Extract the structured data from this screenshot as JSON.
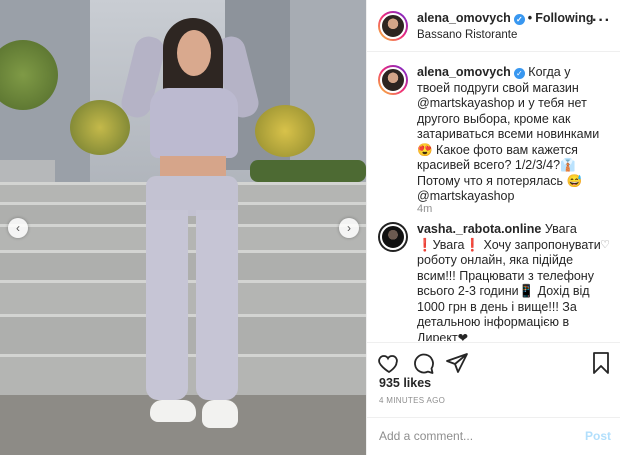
{
  "post": {
    "username": "alena_omovych",
    "follow_label": "Following",
    "location": "Bassano Ristorante",
    "more_label": "···"
  },
  "caption": {
    "username": "alena_omovych",
    "text": "Когда у твоей подруги свой магазин @martskayashop и у тебя нет другого выбора, кроме как затариваться всеми новинками😍 Какое фото вам кажется красивей всего? 1/2/3/4?👔Потому что я потерялась 😅 @martskayashop",
    "time": "4m"
  },
  "comment": {
    "username": "vasha._rabota.online",
    "first_word": "Увага",
    "text": "❗Увага❗ Хочу запропонувати роботу онлайн, яка підійде всим!!! Працювати з телефону всього 2-3 години📱 Дохід від 1000 грн в день і вище!!! За детальною інформацією в Директ❤"
  },
  "stats": {
    "likes": "935 likes",
    "posted": "4 MINUTES AGO"
  },
  "add_comment": {
    "placeholder": "Add a comment...",
    "post_label": "Post"
  },
  "icons": {
    "prev": "chevron-left-icon",
    "next": "chevron-right-icon",
    "like": "heart-icon",
    "comment": "comment-icon",
    "share": "share-icon",
    "save": "bookmark-icon"
  },
  "colors": {
    "link": "#3897f0",
    "post_disabled": "#b2dffc"
  }
}
